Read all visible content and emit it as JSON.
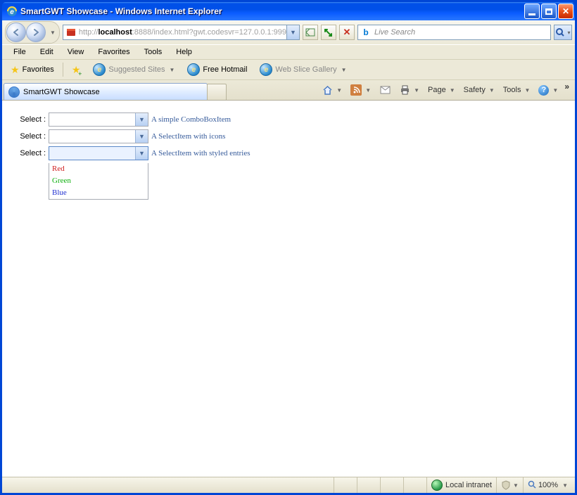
{
  "window": {
    "title": "SmartGWT Showcase - Windows Internet Explorer"
  },
  "nav": {
    "address_prefix": "http://",
    "address_host": "localhost",
    "address_port_path": ":8888/index.html?gwt.codesvr=127.0.0.1:999",
    "search_placeholder": "Live Search"
  },
  "menu": {
    "file": "File",
    "edit": "Edit",
    "view": "View",
    "favorites": "Favorites",
    "tools": "Tools",
    "help": "Help"
  },
  "favbar": {
    "favorites": "Favorites",
    "suggested": "Suggested Sites",
    "hotmail": "Free Hotmail",
    "webslice": "Web Slice Gallery"
  },
  "tab": {
    "title": "SmartGWT Showcase"
  },
  "tools": {
    "page": "Page",
    "safety": "Safety",
    "tools": "Tools"
  },
  "form": {
    "label": "Select :",
    "desc1": "A simple ComboBoxItem",
    "desc2": "A SelectItem with icons",
    "desc3": "A SelectItem with styled entries",
    "options": {
      "red": "Red",
      "green": "Green",
      "blue": "Blue"
    }
  },
  "status": {
    "zone": "Local intranet",
    "zoom": "100%"
  }
}
